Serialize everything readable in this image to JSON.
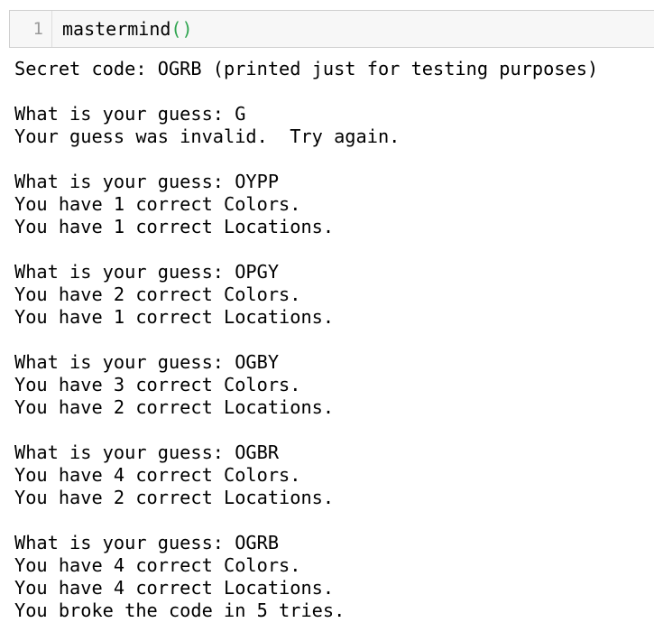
{
  "cell": {
    "line_number": "1",
    "code_name": "mastermind",
    "code_parens": "()"
  },
  "output": {
    "lines": [
      "Secret code: OGRB (printed just for testing purposes)",
      "",
      "What is your guess: G",
      "Your guess was invalid.  Try again.",
      "",
      "What is your guess: OYPP",
      "You have 1 correct Colors.",
      "You have 1 correct Locations.",
      "",
      "What is your guess: OPGY",
      "You have 2 correct Colors.",
      "You have 1 correct Locations.",
      "",
      "What is your guess: OGBY",
      "You have 3 correct Colors.",
      "You have 2 correct Locations.",
      "",
      "What is your guess: OGBR",
      "You have 4 correct Colors.",
      "You have 2 correct Locations.",
      "",
      "What is your guess: OGRB",
      "You have 4 correct Colors.",
      "You have 4 correct Locations.",
      "You broke the code in 5 tries."
    ]
  }
}
